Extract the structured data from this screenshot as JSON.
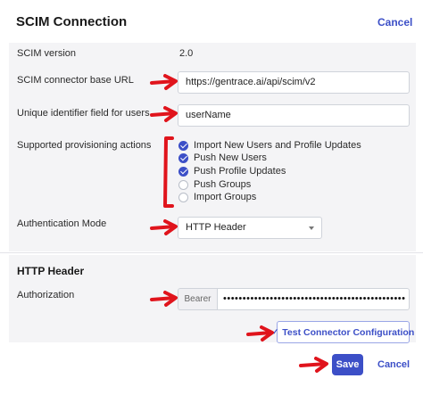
{
  "header": {
    "title": "SCIM Connection",
    "cancel_label": "Cancel"
  },
  "form": {
    "scim_version": {
      "label": "SCIM version",
      "value": "2.0"
    },
    "base_url": {
      "label": "SCIM connector base URL",
      "value": "https://gentrace.ai/api/scim/v2"
    },
    "unique_id": {
      "label": "Unique identifier field for users",
      "value": "userName"
    },
    "provisioning": {
      "label": "Supported provisioning actions",
      "options": [
        {
          "label": "Import New Users and Profile Updates",
          "checked": true
        },
        {
          "label": "Push New Users",
          "checked": true
        },
        {
          "label": "Push Profile Updates",
          "checked": true
        },
        {
          "label": "Push Groups",
          "checked": false
        },
        {
          "label": "Import Groups",
          "checked": false
        }
      ]
    },
    "auth_mode": {
      "label": "Authentication Mode",
      "value": "HTTP Header"
    }
  },
  "http_header": {
    "title": "HTTP Header",
    "authorization": {
      "label": "Authorization",
      "prefix": "Bearer",
      "value": "•••••••••••••••••••••••••••••••••••••••••••••••"
    }
  },
  "actions": {
    "test_label": "Test Connector Configuration",
    "save_label": "Save",
    "cancel_label": "Cancel"
  },
  "colors": {
    "accent": "#3c4fc7",
    "annotation": "#e0141c",
    "panel": "#f4f4f6"
  },
  "icons": {
    "checkbox_checked": "check-icon",
    "select_caret": "chevron-down-icon"
  }
}
